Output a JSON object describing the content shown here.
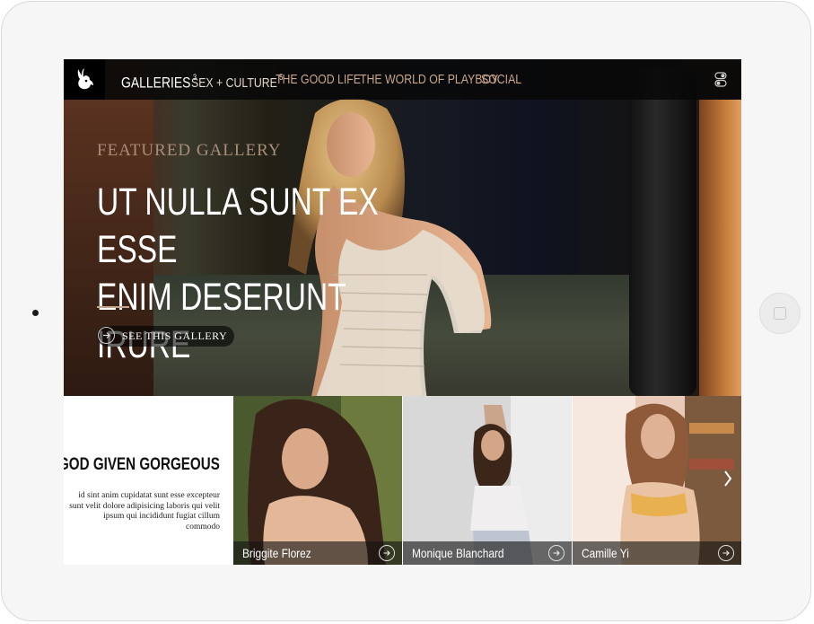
{
  "nav": {
    "items": [
      {
        "label": "GALLERIES",
        "count": "3",
        "active": true
      },
      {
        "label": "SEX + CULTURE",
        "count": "5",
        "active": false
      },
      {
        "label": "THE GOOD LIFE",
        "count": "",
        "active": false
      },
      {
        "label": "THE WORLD OF PLAYBOY",
        "count": "",
        "active": false
      },
      {
        "label": "SOCIAL",
        "count": "",
        "active": false
      }
    ]
  },
  "hero": {
    "overline": "FEATURED GALLERY",
    "title_line1": "UT NULLA SUNT EX ESSE",
    "title_line2": "ENIM DESERUNT IRURE",
    "cta_label": "SEE THIS GALLERY"
  },
  "feature": {
    "title": "GOD GIVEN GORGEOUS",
    "description": "id sint anim cupidatat sunt esse excepteur sunt velit dolore adipisicing laboris qui velit ipsum qui incididunt fugiat cillum commodo"
  },
  "cards": [
    {
      "name": "Briggite Florez"
    },
    {
      "name": "Monique Blanchard"
    },
    {
      "name": "Camille Yi"
    }
  ],
  "colors": {
    "accent": "#c9a58d",
    "nav_bg": "#080808",
    "active_nav": "#ffffff"
  },
  "icons": {
    "logo": "bunny-logo-icon",
    "settings": "toggle-icon",
    "cta": "arrow-right-icon",
    "next": "chevron-right-icon"
  }
}
